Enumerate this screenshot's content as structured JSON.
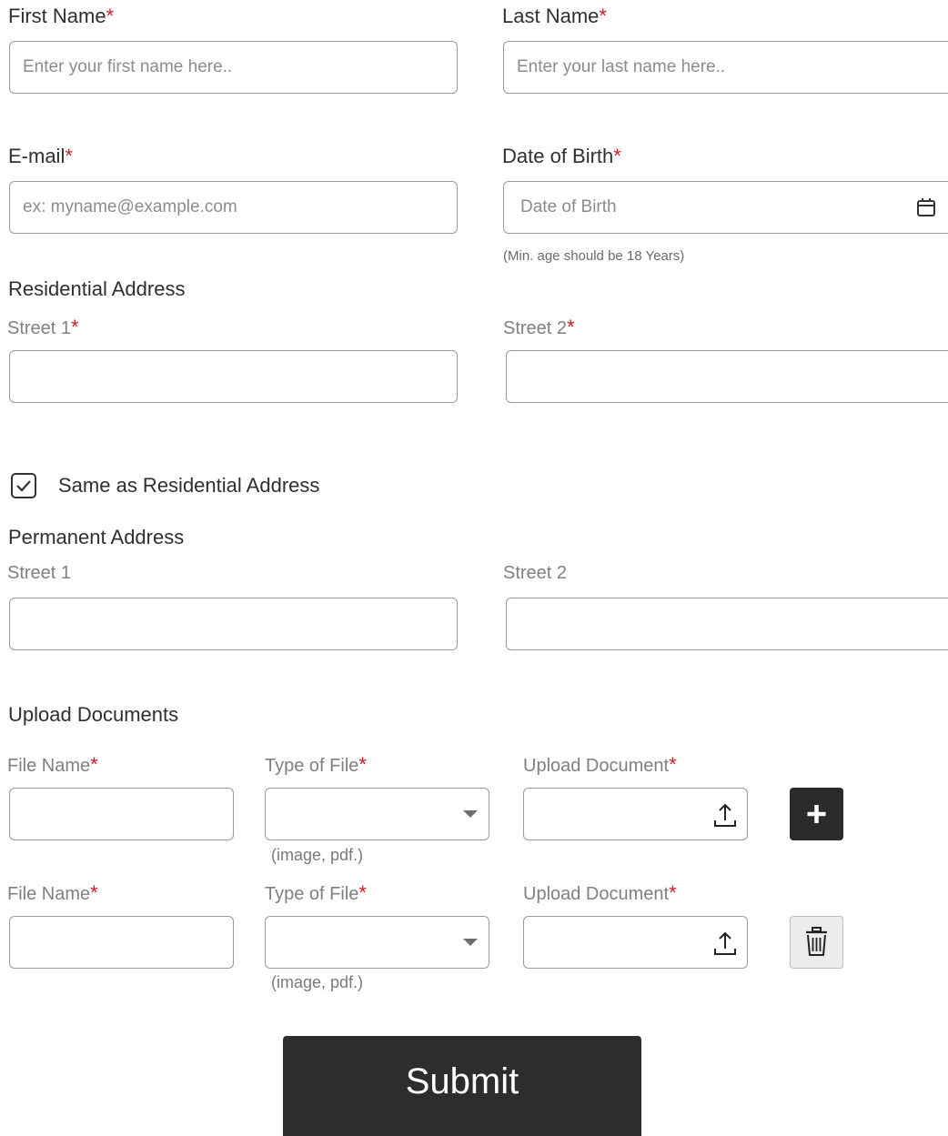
{
  "personal": {
    "first_name_label": "First Name",
    "first_name_placeholder": "Enter your first name here..",
    "last_name_label": "Last Name",
    "last_name_placeholder": "Enter your last name here..",
    "email_label": "E-mail",
    "email_placeholder": "ex: myname@example.com",
    "dob_label": "Date of Birth",
    "dob_placeholder": "Date of Birth",
    "dob_hint": "(Min. age should be 18 Years)",
    "required_mark": "*"
  },
  "residential": {
    "title": "Residential Address",
    "street1_label": "Street 1",
    "street2_label": "Street 2"
  },
  "same_as": {
    "label": "Same as Residential Address",
    "checked": true
  },
  "permanent": {
    "title": "Permanent Address",
    "street1_label": "Street 1",
    "street2_label": "Street 2"
  },
  "uploads": {
    "title": "Upload Documents",
    "rows": [
      {
        "file_name_label": "File Name",
        "type_label": "Type of File",
        "type_hint": "(image, pdf.)",
        "upload_label": "Upload Document",
        "action": "add"
      },
      {
        "file_name_label": "File Name",
        "type_label": "Type of File",
        "type_hint": "(image, pdf.)",
        "upload_label": "Upload Document",
        "action": "delete"
      }
    ]
  },
  "submit_label": "Submit",
  "colors": {
    "required": "#c81e24",
    "dark_button": "#2b2b2b",
    "border": "#9a9a9a"
  },
  "icons": [
    "calendar-icon",
    "check-icon",
    "upload-icon",
    "plus-icon",
    "trash-icon",
    "chevron-down-icon"
  ]
}
